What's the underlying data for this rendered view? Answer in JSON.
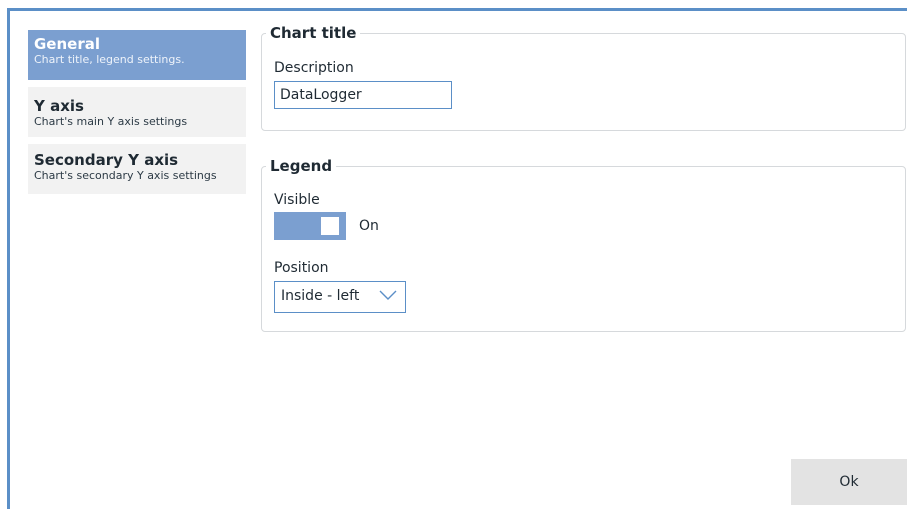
{
  "sidebar": {
    "items": [
      {
        "title": "General",
        "subtitle": "Chart title, legend settings."
      },
      {
        "title": "Y axis",
        "subtitle": "Chart's main Y axis settings"
      },
      {
        "title": "Secondary Y axis",
        "subtitle": "Chart's secondary Y axis settings"
      }
    ],
    "active_index": 0
  },
  "chart_title_group": {
    "legend": "Chart title",
    "description_label": "Description",
    "description_value": "DataLogger"
  },
  "legend_group": {
    "legend": "Legend",
    "visible_label": "Visible",
    "visible_state": "On",
    "position_label": "Position",
    "position_value": "Inside - left"
  },
  "footer": {
    "ok_label": "Ok"
  },
  "colors": {
    "accent": "#5b8fc7",
    "active_tab": "#7b9fd0",
    "inactive_tab": "#f2f2f2",
    "button": "#e3e3e3"
  }
}
